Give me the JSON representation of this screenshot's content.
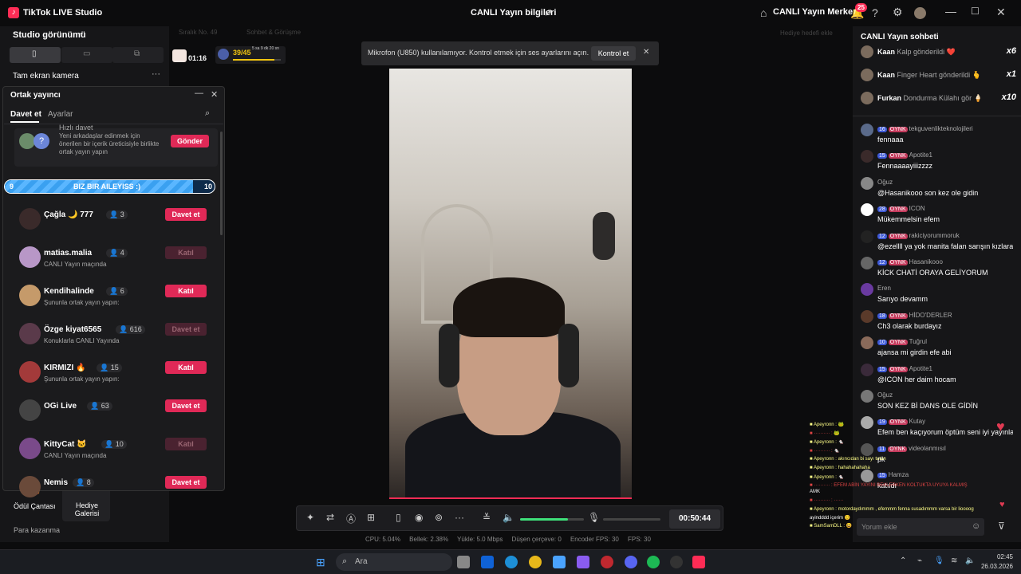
{
  "titlebar": {
    "app": "TikTok LIVE Studio",
    "center": "CANLI Yayın bilgileri",
    "live_center": "CANLI Yayın Merkezi",
    "notif_count": "25"
  },
  "left": {
    "view_title": "Studio görünümü",
    "source": "Tam ekran kamera",
    "gift_bag": "Ödül Çantası",
    "gift_gallery": "Hediye Galerisi",
    "earn": "Para kazanma"
  },
  "topstats": {
    "timer": "01:16",
    "goal": "39/45",
    "goal_sub": "5 sa 9 dk 20 sn",
    "sorting": "Sıralık No. 49",
    "talk": "Sohbet & Görüşme",
    "gift_goal": "Hediye hedefi ekle"
  },
  "cohost": {
    "title": "Ortak yayıncı",
    "tab_invite": "Davet et",
    "tab_settings": "Ayarlar",
    "quick_title": "Hızlı davet",
    "quick_text": "Yeni arkadaşlar edinmek için önerilen bir içerik üreticisiyle birlikte ortak yayın yapın",
    "quick_btn": "Gönder",
    "bar_left": "9",
    "bar_label": "BIZ BIR AILEYISS :)",
    "bar_right": "10",
    "bar_progress": 0.9,
    "rows": [
      {
        "name": "Çağla 🌙 777",
        "count": "3",
        "sub": "",
        "btn": "Davet et",
        "enabled": true
      },
      {
        "name": "matias.malia",
        "count": "4",
        "sub": "CANLI Yayın maçında",
        "btn": "Katıl",
        "enabled": false
      },
      {
        "name": "Kendihalinde",
        "count": "6",
        "sub": "Şununla ortak yayın yapın:",
        "btn": "Katıl",
        "enabled": true
      },
      {
        "name": "Özge kiyat6565",
        "count": "616",
        "sub": "Konuklarla CANLI Yayında",
        "btn": "Davet et",
        "enabled": false
      },
      {
        "name": "KIRMIZI 🔥",
        "count": "15",
        "sub": "Şununla ortak yayın yapın:",
        "btn": "Katıl",
        "enabled": true
      },
      {
        "name": "OGi Live",
        "count": "63",
        "sub": "",
        "btn": "Davet et",
        "enabled": true
      },
      {
        "name": "KittyCat 🐱",
        "count": "10",
        "sub": "CANLI Yayın maçında",
        "btn": "Katıl",
        "enabled": false
      },
      {
        "name": "Nemis",
        "count": "8",
        "sub": "",
        "btn": "Davet et",
        "enabled": true
      }
    ]
  },
  "toast": {
    "text": "Mikrofon (U850) kullanılamıyor. Kontrol etmek için ses ayarlarını açın.",
    "btn": "Kontrol et"
  },
  "chat": {
    "title": "CANLI Yayın sohbeti",
    "gifts": [
      {
        "user": "Kaan",
        "text": "Kalp gönderildi",
        "count": "x6",
        "icon": "❤️"
      },
      {
        "user": "Kaan",
        "text": "Finger Heart gönderildi",
        "count": "x1",
        "icon": "🫰"
      },
      {
        "user": "Furkan",
        "text": "Dondurma Külahı gör",
        "count": "x10",
        "icon": "🍦"
      }
    ],
    "messages": [
      {
        "lvl": "16",
        "user": "tekguvenlikteknolojileri",
        "text": "fennaaa",
        "badge": "OYNK"
      },
      {
        "lvl": "15",
        "user": "Apotite1",
        "text": "Fennaaaayiiizzzz",
        "badge": "OYNK"
      },
      {
        "lvl": "",
        "user": "Oğuz",
        "text": "@Hasanikooo son kez ole gidin",
        "badge": ""
      },
      {
        "lvl": "28",
        "user": "ICON",
        "text": "Mükemmelsin efem",
        "badge": "OYNK"
      },
      {
        "lvl": "12",
        "user": "rakiciyorummoruk",
        "text": "@ezellll ya yok manita falan sarışın kızlara kapım açık",
        "badge": "OYNK"
      },
      {
        "lvl": "12",
        "user": "Hasanikooo",
        "text": "KİCK CHATİ ORAYA GELİYORUM",
        "badge": "OYNK"
      },
      {
        "lvl": "",
        "user": "Eren",
        "text": "Sarıyo devamm",
        "badge": ""
      },
      {
        "lvl": "18",
        "user": "HİDO'DERLER",
        "text": "Ch3 olarak burdayız",
        "badge": "OYNK"
      },
      {
        "lvl": "10",
        "user": "Tuğrul",
        "text": "ajansa mi girdin efe abi",
        "badge": "OYNK"
      },
      {
        "lvl": "15",
        "user": "Apotite1",
        "text": "@ICON her daim hocam",
        "badge": "OYNK"
      },
      {
        "lvl": "",
        "user": "Oğuz",
        "text": "SON KEZ Bİ DANS OLE GİDİN",
        "badge": ""
      },
      {
        "lvl": "19",
        "user": "Kutay",
        "text": "Efem ben kaçıyorum öptüm seni iyi yayınlar iyi geceler",
        "badge": "OYNK"
      },
      {
        "lvl": "11",
        "user": "videolanmısıl",
        "text": "pk",
        "badge": "OYNK"
      },
      {
        "lvl": "15",
        "user": "Hamza",
        "text": "katıldı",
        "badge": ""
      }
    ],
    "input_placeholder": "Yorum ekle"
  },
  "controls": {
    "time": "00:50:44",
    "volume": 0.75
  },
  "status": {
    "cpu": "CPU: 5.04%",
    "mem": "Bellek: 2.38%",
    "upload": "Yükle: 5.0 Mbps",
    "drop": "Düşen çerçeve: 0",
    "enc": "Encoder FPS: 30",
    "fps": "FPS: 30"
  },
  "taskbar": {
    "search": "Ara",
    "time": "02:45",
    "date": "26.03.2026"
  }
}
